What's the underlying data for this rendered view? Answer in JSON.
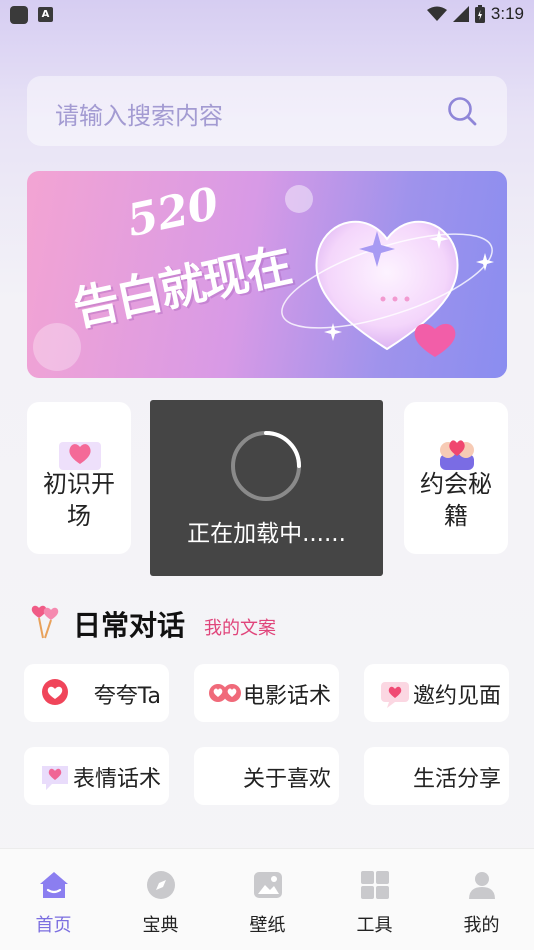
{
  "status_bar": {
    "time": "3:19",
    "notification_letter": "A"
  },
  "search": {
    "placeholder": "请输入搜索内容"
  },
  "banner": {
    "number": "520",
    "slogan": "告白就现在"
  },
  "feature_cards": [
    {
      "label": "初识开场",
      "icon": "heart-envelope-icon"
    },
    {
      "label": "约会秘籍",
      "icon": "heart-hands-icon"
    }
  ],
  "loading_toast": {
    "text": "正在加载中......"
  },
  "daily_section": {
    "title": "日常对话",
    "link": "我的文案"
  },
  "chips": [
    {
      "label": "夸夸Ta",
      "icon": "heart-balloon-icon"
    },
    {
      "label": "电影话术",
      "icon": "movie-hearts-icon"
    },
    {
      "label": "邀约见面",
      "icon": "heart-message-icon"
    },
    {
      "label": "表情话术",
      "icon": "heart-chat-icon"
    },
    {
      "label": "关于喜欢",
      "icon": ""
    },
    {
      "label": "生活分享",
      "icon": ""
    }
  ],
  "tabs": [
    {
      "label": "首页",
      "icon": "home-icon",
      "active": true
    },
    {
      "label": "宝典",
      "icon": "compass-icon",
      "active": false
    },
    {
      "label": "壁纸",
      "icon": "wallpaper-icon",
      "active": false
    },
    {
      "label": "工具",
      "icon": "grid-icon",
      "active": false
    },
    {
      "label": "我的",
      "icon": "person-icon",
      "active": false
    }
  ],
  "colors": {
    "accent": "#7c6fe0",
    "pink": "#e0457b",
    "toast_bg": "#454545"
  }
}
